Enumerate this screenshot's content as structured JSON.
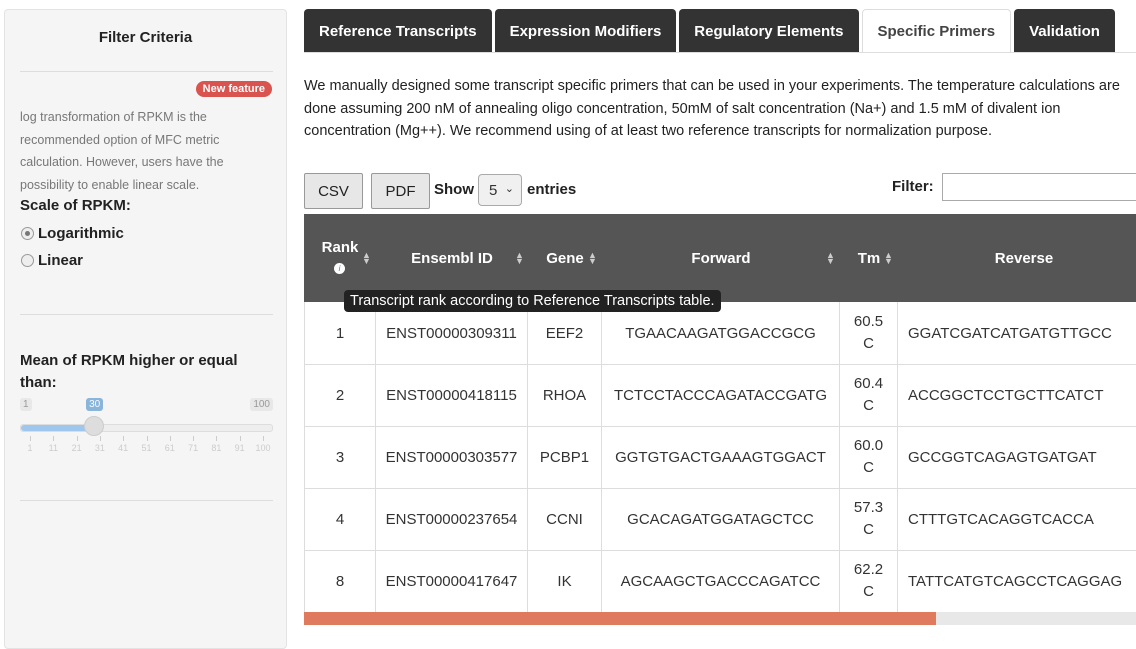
{
  "sidebar": {
    "title": "Filter Criteria",
    "badge": "New feature",
    "help_text": "log transformation of RPKM is the recommended option of MFC metric calculation. However, users have the possibility to enable linear scale.",
    "scale_label": "Scale of RPKM:",
    "scale_options": [
      "Logarithmic",
      "Linear"
    ],
    "scale_selected": "Logarithmic",
    "mean_label": "Mean of RPKM higher or equal than:",
    "slider": {
      "min": "1",
      "max": "100",
      "value": "30",
      "value_num": 30,
      "ticks": [
        "1",
        "11",
        "21",
        "31",
        "41",
        "51",
        "61",
        "71",
        "81",
        "91",
        "100"
      ]
    }
  },
  "tabs": [
    "Reference Transcripts",
    "Expression Modifiers",
    "Regulatory Elements",
    "Specific Primers",
    "Validation"
  ],
  "active_tab": "Specific Primers",
  "intro": "We manually designed some transcript specific primers that can be used in your experiments. The temperature calculations are done assuming 200 nM of annealing oligo concentration, 50mM of salt concentration (Na+) and 1.5 mM of divalent ion concentration (Mg++). We recommend using of at least two reference transcripts for normalization purpose.",
  "toolbar": {
    "csv": "CSV",
    "pdf": "PDF",
    "show": "Show",
    "entries_value": "5",
    "entries": "entries",
    "filter": "Filter:"
  },
  "table": {
    "headers": [
      "Rank",
      "Ensembl ID",
      "Gene",
      "Forward",
      "Tm",
      "Reverse"
    ],
    "rows": [
      [
        "1",
        "ENST00000309311",
        "EEF2",
        "TGAACAAGATGGACCGCG",
        "60.5 C",
        "GGATCGATCATGATGTTGCC"
      ],
      [
        "2",
        "ENST00000418115",
        "RHOA",
        "TCTCCTACCCAGATACCGATG",
        "60.4 C",
        "ACCGGCTCCTGCTTCATCT"
      ],
      [
        "3",
        "ENST00000303577",
        "PCBP1",
        "GGTGTGACTGAAAGTGGACT",
        "60.0 C",
        "GCCGGTCAGAGTGATGAT"
      ],
      [
        "4",
        "ENST00000237654",
        "CCNI",
        "GCACAGATGGATAGCTCC",
        "57.3 C",
        "CTTTGTCACAGGTCACCA"
      ],
      [
        "8",
        "ENST00000417647",
        "IK",
        "AGCAAGCTGACCCAGATCC",
        "62.2 C",
        "TATTCATGTCAGCCTCAGGAG"
      ]
    ]
  },
  "tooltip": "Transcript rank according to Reference Transcripts table.",
  "scroll_fraction": 0.76,
  "colors": {
    "tab_dark": "#333333",
    "badge": "#d9534f",
    "scroll_thumb": "#e07a5f",
    "header_bg": "#555555"
  }
}
